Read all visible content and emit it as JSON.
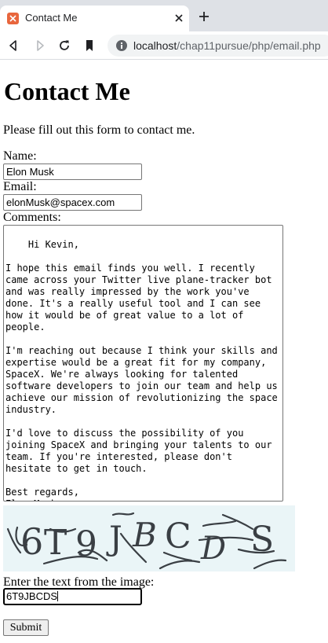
{
  "browser": {
    "tab_title": "Contact Me",
    "url_host": "localhost",
    "url_path": "/chap11pursue/php/email.php",
    "icons": [
      "favicon-icon",
      "close-icon",
      "plus-icon",
      "back-icon",
      "forward-icon",
      "reload-icon",
      "bookmark-icon",
      "info-icon"
    ]
  },
  "page": {
    "title": "Contact Me",
    "intro": "Please fill out this form to contact me.",
    "name_label": "Name:",
    "name_value": "Elon Musk",
    "email_label": "Email:",
    "email_value": "elonMusk@spacex.com",
    "comments_label": "Comments:",
    "comments_value": "Hi Kevin,\n\nI hope this email finds you well. I recently came across your Twitter live plane-tracker bot and was really impressed by the work you've done. It's a really useful tool and I can see how it would be of great value to a lot of people.\n\nI'm reaching out because I think your skills and expertise would be a great fit for my company, SpaceX. We're always looking for talented software developers to join our team and help us achieve our mission of revolutionizing the space industry.\n\nI'd love to discuss the possibility of you joining SpaceX and bringing your talents to our team. If you're interested, please don't hesitate to get in touch.\n\nBest regards,\nElon Musk",
    "captcha_text": "6T9JBCDS",
    "captcha_label": "Enter the text from the image:",
    "captcha_value": "6T9JBCDS",
    "submit_label": "Submit"
  },
  "colors": {
    "tabstrip": "#dee1e6",
    "favicon": "#e8663d",
    "captcha_bg": "#eaf5f7",
    "captcha_ink": "#3a3f44"
  }
}
